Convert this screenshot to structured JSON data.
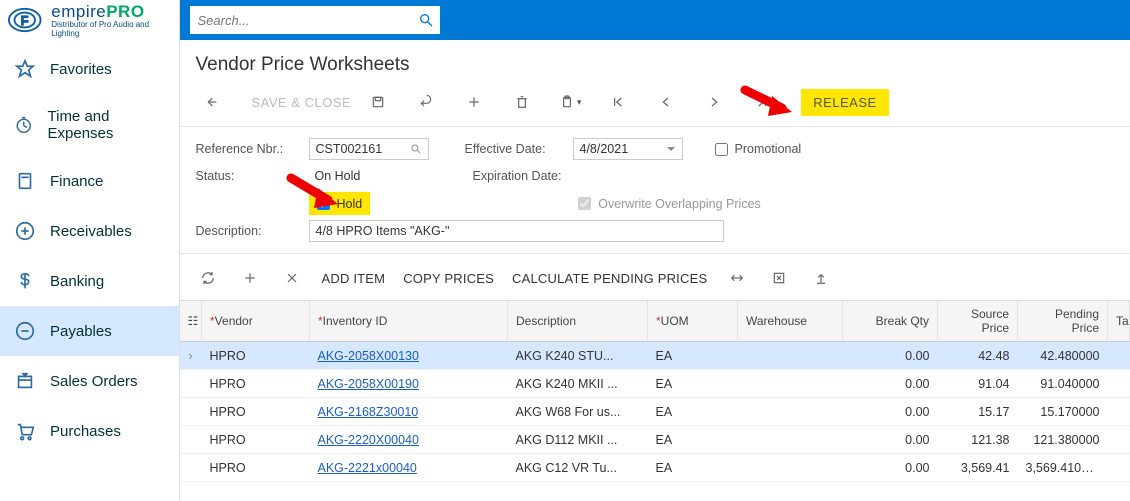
{
  "search_placeholder": "Search...",
  "logo": {
    "brand": "empire",
    "suffix": "PRO",
    "tagline": "Distributor of Pro Audio and Lighting"
  },
  "sidebar": {
    "items": [
      {
        "label": "Favorites",
        "icon": "star",
        "name": "favorites"
      },
      {
        "label": "Time and Expenses",
        "icon": "clock",
        "name": "time-and-expenses"
      },
      {
        "label": "Finance",
        "icon": "calculator",
        "name": "finance"
      },
      {
        "label": "Receivables",
        "icon": "plus-circle",
        "name": "receivables"
      },
      {
        "label": "Banking",
        "icon": "dollar",
        "name": "banking"
      },
      {
        "label": "Payables",
        "icon": "minus-circle",
        "name": "payables"
      },
      {
        "label": "Sales Orders",
        "icon": "box",
        "name": "sales-orders"
      },
      {
        "label": "Purchases",
        "icon": "cart",
        "name": "purchases"
      }
    ],
    "active_index": 5
  },
  "page_title": "Vendor Price Worksheets",
  "toolbar": {
    "save_close_label": "SAVE & CLOSE",
    "release_label": "RELEASE"
  },
  "form": {
    "ref_label": "Reference Nbr.:",
    "ref_value": "CST002161",
    "status_label": "Status:",
    "status_value": "On Hold",
    "hold_label": "Hold",
    "hold_checked": true,
    "desc_label": "Description:",
    "desc_value": "4/8 HPRO Items \"AKG-\"",
    "eff_label": "Effective Date:",
    "eff_value": "4/8/2021",
    "exp_label": "Expiration Date:",
    "promo_label": "Promotional",
    "promo_checked": false,
    "overlap_label": "Overwrite Overlapping Prices",
    "overlap_checked": true
  },
  "grid_actions": {
    "add_item": "ADD ITEM",
    "copy_prices": "COPY PRICES",
    "calc_pending": "CALCULATE PENDING PRICES"
  },
  "grid": {
    "columns": [
      "Vendor",
      "Inventory ID",
      "Description",
      "UOM",
      "Warehouse",
      "Break Qty",
      "Source Price",
      "Pending Price",
      "Ta"
    ],
    "rows": [
      {
        "vendor": "HPRO",
        "inv": "AKG-2058X00130",
        "desc": "AKG K240 STU...",
        "uom": "EA",
        "wh": "",
        "bq": "0.00",
        "sp": "42.48",
        "pp": "42.480000"
      },
      {
        "vendor": "HPRO",
        "inv": "AKG-2058X00190",
        "desc": "AKG K240 MKII ...",
        "uom": "EA",
        "wh": "",
        "bq": "0.00",
        "sp": "91.04",
        "pp": "91.040000"
      },
      {
        "vendor": "HPRO",
        "inv": "AKG-2168Z30010",
        "desc": "AKG W68 For us...",
        "uom": "EA",
        "wh": "",
        "bq": "0.00",
        "sp": "15.17",
        "pp": "15.170000"
      },
      {
        "vendor": "HPRO",
        "inv": "AKG-2220X00040",
        "desc": "AKG D112 MKII ...",
        "uom": "EA",
        "wh": "",
        "bq": "0.00",
        "sp": "121.38",
        "pp": "121.380000"
      },
      {
        "vendor": "HPRO",
        "inv": "AKG-2221x00040",
        "desc": "AKG C12 VR Tu...",
        "uom": "EA",
        "wh": "",
        "bq": "0.00",
        "sp": "3,569.41",
        "pp": "3,569.410000"
      }
    ],
    "selected_row": 0
  }
}
